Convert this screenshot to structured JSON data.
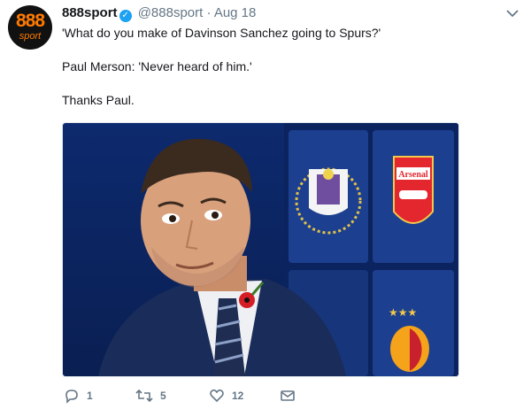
{
  "account": {
    "name": "888sport",
    "handle": "@888sport",
    "separator": "·",
    "date": "Aug 18",
    "avatar_text": "888",
    "avatar_subtext": "sport",
    "avatar_color": "#ff7a00"
  },
  "tweet": {
    "lines": [
      "'What do you make of Davinson Sanchez going to Spurs?'",
      "Paul Merson: 'Never heard of him.'",
      "Thanks Paul."
    ]
  },
  "media": {
    "description_icons": [
      "man-pundit",
      "anderlecht-crest-icon",
      "arsenal-crest-icon",
      "galatasaray-crest-icon"
    ],
    "crest_texts": [
      "Arsenal"
    ]
  },
  "actions": {
    "reply_count": "1",
    "retweet_count": "5",
    "like_count": "12"
  },
  "colors": {
    "link_blue": "#1da1f2",
    "meta_gray": "#657786"
  }
}
